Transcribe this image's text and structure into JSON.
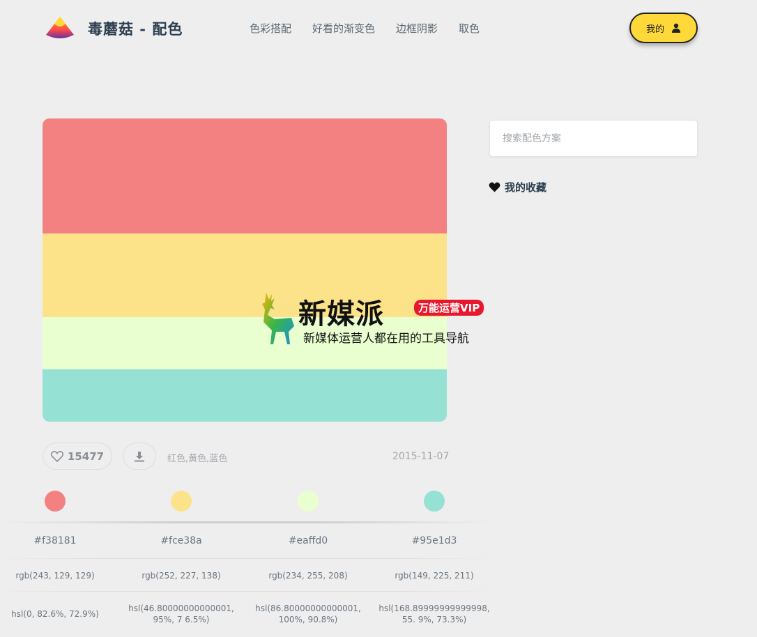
{
  "header": {
    "brand": "毒蘑菇 - 配色",
    "nav": [
      "色彩搭配",
      "好看的渐变色",
      "边框阴影",
      "取色"
    ],
    "me_label": "我的"
  },
  "palette": {
    "colors": [
      "#f38181",
      "#fce38a",
      "#eaffd0",
      "#95e1d3"
    ],
    "likes": "15477",
    "tags": "红色,黄色,蓝色",
    "date": "2015-11-07",
    "hex": [
      "#f38181",
      "#fce38a",
      "#eaffd0",
      "#95e1d3"
    ],
    "rgb": [
      "rgb(243, 129, 129)",
      "rgb(252, 227, 138)",
      "rgb(234, 255, 208)",
      "rgb(149, 225, 211)"
    ],
    "hsl": [
      "hsl(0, 82.6%, 72.9%)",
      "hsl(46.80000000000001, 95%, 7 6.5%)",
      "hsl(86.80000000000001, 100%, 90.8%)",
      "hsl(168.89999999999998, 55. 9%, 73.3%)"
    ]
  },
  "sidebar": {
    "search_placeholder": "搜索配色方案",
    "favorites_label": "我的收藏"
  },
  "watermark": {
    "title": "新媒派",
    "badge": "万能运营VIP",
    "subtitle": "新媒体运营人都在用的工具导航"
  }
}
